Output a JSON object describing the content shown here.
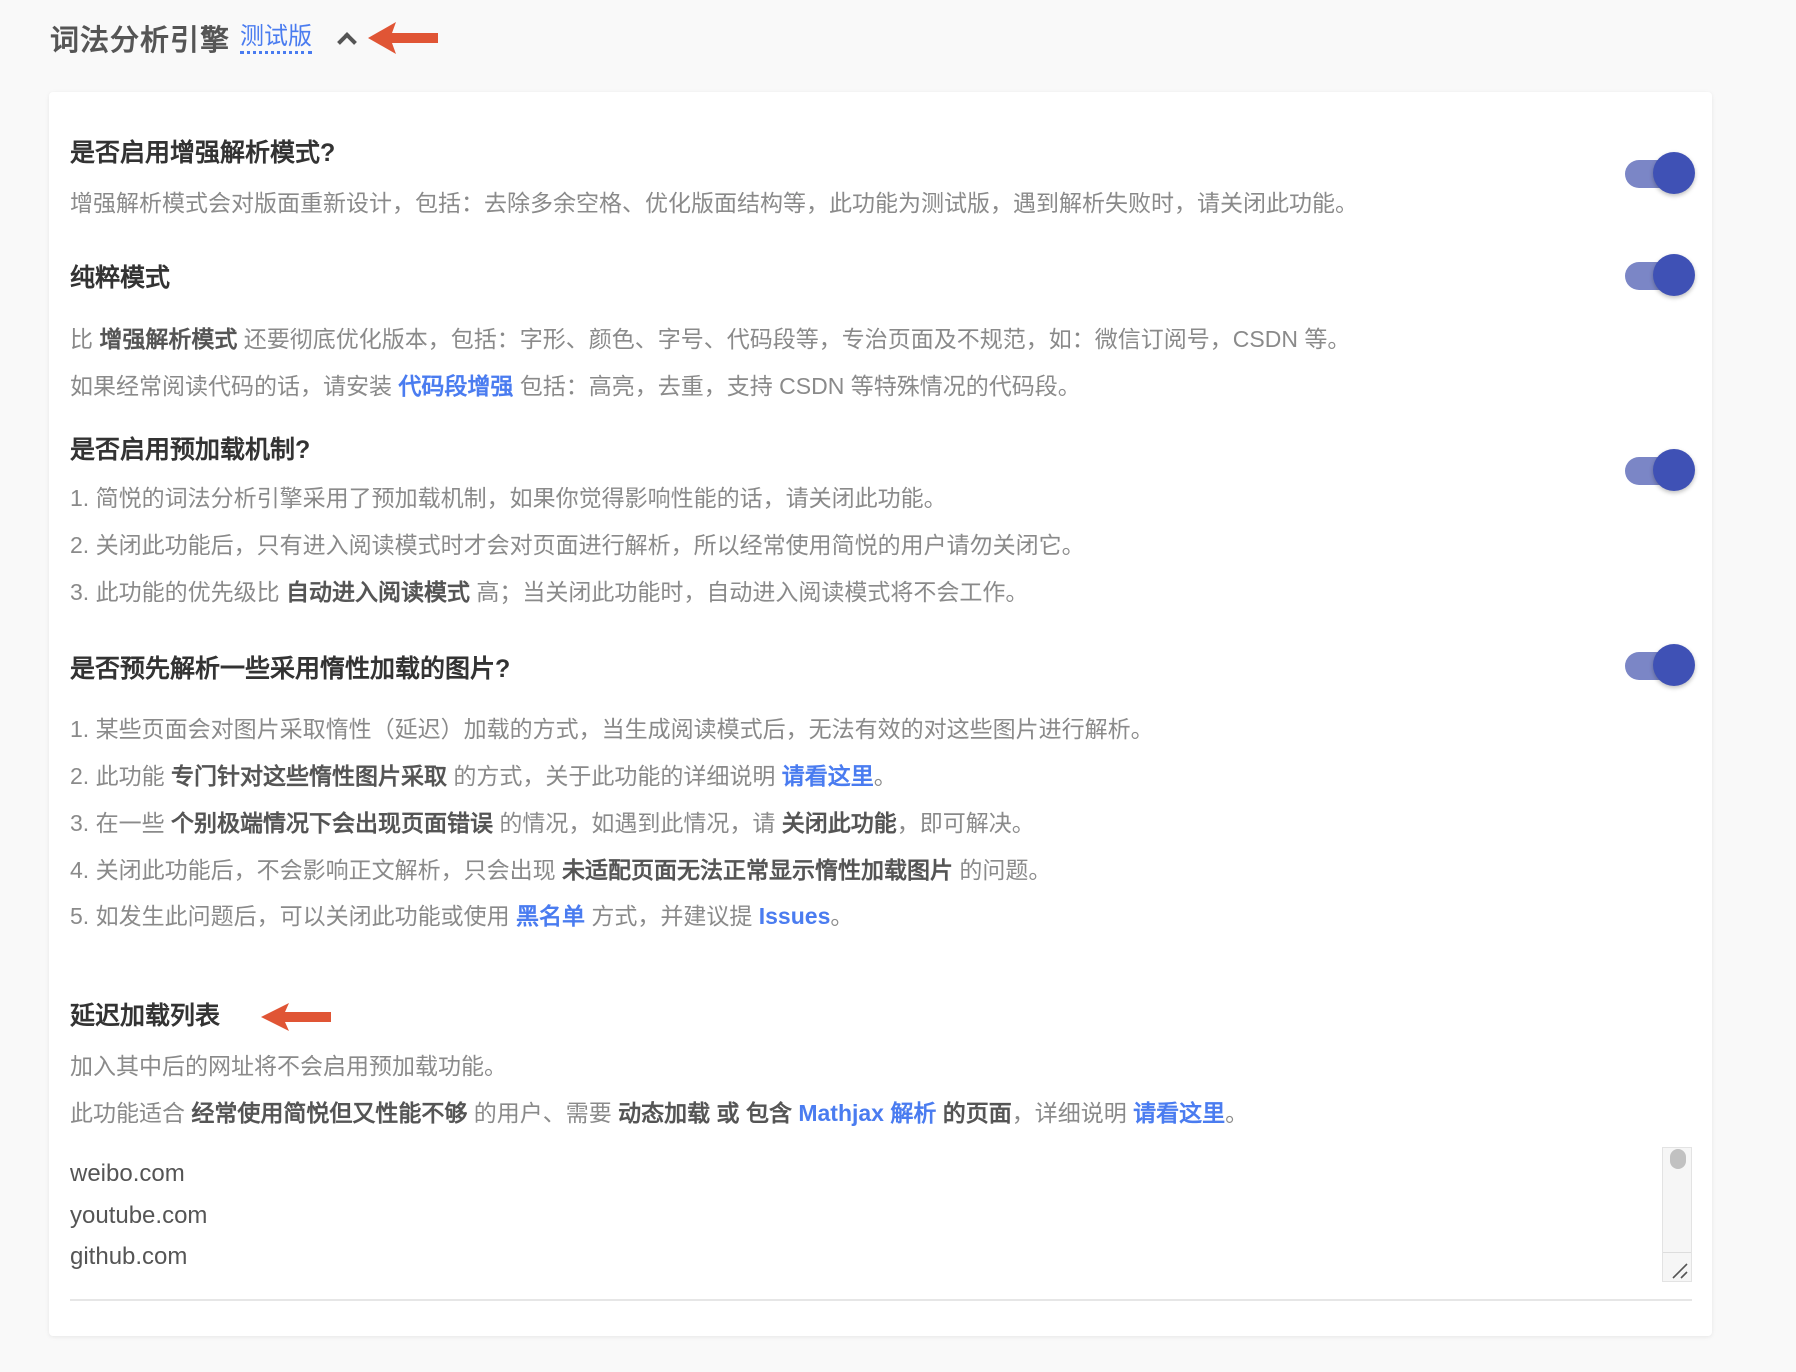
{
  "header": {
    "title": "词法分析引擎",
    "beta_label": "测试版"
  },
  "colors": {
    "accent": "#4a7cf0",
    "toggle_on": "#3f51b5",
    "arrow": "#e05535"
  },
  "sections": [
    {
      "title": "是否启用增强解析模式?",
      "toggle_on": true,
      "lines": [
        [
          {
            "text": "增强解析模式会对版面重新设计，包括：去除多余空格、优化版面结构等，此功能为测试版，遇到解析失败时，请关闭此功能。",
            "style": "n"
          }
        ]
      ]
    },
    {
      "title": "纯粹模式",
      "toggle_on": true,
      "lines": [
        [
          {
            "text": "比 ",
            "style": "n"
          },
          {
            "text": "增强解析模式",
            "style": "b"
          },
          {
            "text": " 还要彻底优化版本，包括：字形、颜色、字号、代码段等，专治页面及不规范，如：微信订阅号，CSDN 等。",
            "style": "n"
          }
        ],
        [
          {
            "text": "如果经常阅读代码的话，请安装 ",
            "style": "n"
          },
          {
            "text": "代码段增强",
            "style": "l"
          },
          {
            "text": " 包括：高亮，去重，支持 CSDN 等特殊情况的代码段。",
            "style": "n"
          }
        ]
      ]
    },
    {
      "title": "是否启用预加载机制?",
      "toggle_on": true,
      "lines": [
        [
          {
            "text": "1. 简悦的词法分析引擎采用了预加载机制，如果你觉得影响性能的话，请关闭此功能。",
            "style": "n"
          }
        ],
        [
          {
            "text": "2. 关闭此功能后，只有进入阅读模式时才会对页面进行解析，所以经常使用简悦的用户请勿关闭它。",
            "style": "n"
          }
        ],
        [
          {
            "text": "3. 此功能的优先级比 ",
            "style": "n"
          },
          {
            "text": "自动进入阅读模式",
            "style": "b"
          },
          {
            "text": " 高；当关闭此功能时，自动进入阅读模式将不会工作。",
            "style": "n"
          }
        ]
      ]
    },
    {
      "title": "是否预先解析一些采用惰性加载的图片?",
      "toggle_on": true,
      "lines": [
        [
          {
            "text": "1. 某些页面会对图片采取惰性（延迟）加载的方式，当生成阅读模式后，无法有效的对这些图片进行解析。",
            "style": "n"
          }
        ],
        [
          {
            "text": "2. 此功能 ",
            "style": "n"
          },
          {
            "text": "专门针对这些惰性图片采取",
            "style": "b"
          },
          {
            "text": " 的方式，关于此功能的详细说明 ",
            "style": "n"
          },
          {
            "text": "请看这里",
            "style": "l"
          },
          {
            "text": "。",
            "style": "n"
          }
        ],
        [
          {
            "text": "3. 在一些 ",
            "style": "n"
          },
          {
            "text": "个别极端情况下会出现页面错误",
            "style": "b"
          },
          {
            "text": " 的情况，如遇到此情况，请 ",
            "style": "n"
          },
          {
            "text": "关闭此功能",
            "style": "b"
          },
          {
            "text": "，即可解决。",
            "style": "n"
          }
        ],
        [
          {
            "text": "4. 关闭此功能后，不会影响正文解析，只会出现 ",
            "style": "n"
          },
          {
            "text": "未适配页面无法正常显示惰性加载图片",
            "style": "b"
          },
          {
            "text": " 的问题。",
            "style": "n"
          }
        ],
        [
          {
            "text": "5. 如发生此问题后，可以关闭此功能或使用 ",
            "style": "n"
          },
          {
            "text": "黑名单",
            "style": "l"
          },
          {
            "text": " 方式，并建议提 ",
            "style": "n"
          },
          {
            "text": "Issues",
            "style": "l"
          },
          {
            "text": "。",
            "style": "n"
          }
        ]
      ]
    },
    {
      "title": "延迟加载列表",
      "toggle_on": null,
      "lines": [
        [
          {
            "text": "加入其中后的网址将不会启用预加载功能。",
            "style": "n"
          }
        ],
        [
          {
            "text": "此功能适合 ",
            "style": "n"
          },
          {
            "text": "经常使用简悦但又性能不够",
            "style": "b"
          },
          {
            "text": " 的用户、需要 ",
            "style": "n"
          },
          {
            "text": "动态加载 或 包含",
            "style": "b"
          },
          {
            "text": " ",
            "style": "n"
          },
          {
            "text": "Mathjax 解析",
            "style": "l"
          },
          {
            "text": " ",
            "style": "n"
          },
          {
            "text": "的页面",
            "style": "b"
          },
          {
            "text": "，详细说明 ",
            "style": "n"
          },
          {
            "text": "请看这里",
            "style": "l"
          },
          {
            "text": "。",
            "style": "n"
          }
        ]
      ]
    }
  ],
  "lazy_list": [
    "weibo.com",
    "youtube.com",
    "github.com"
  ]
}
